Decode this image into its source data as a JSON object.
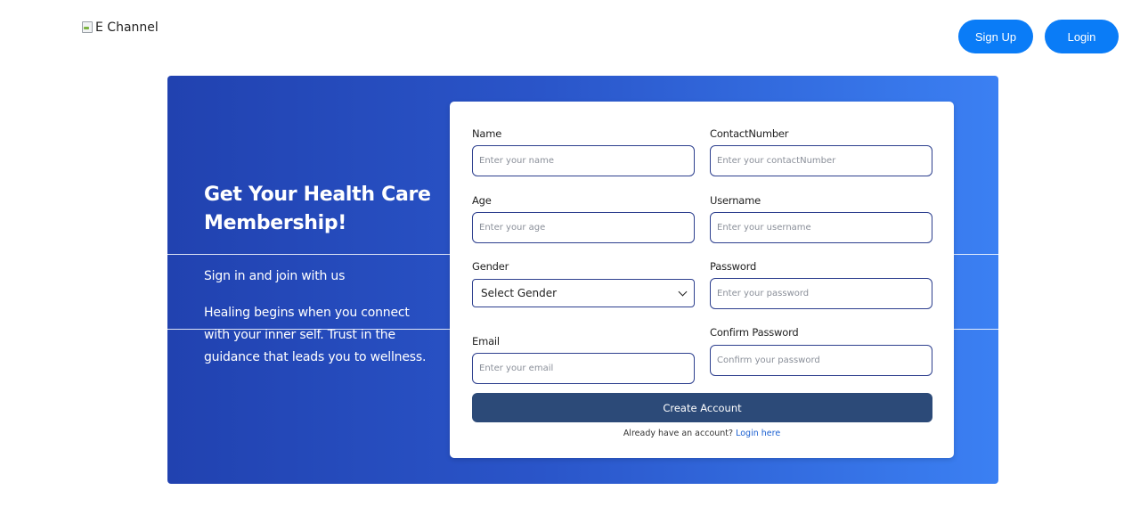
{
  "header": {
    "logo_alt": "E Channel",
    "signup_label": "Sign Up",
    "login_label": "Login"
  },
  "hero": {
    "title": "Get Your Health Care Membership!",
    "subtitle": "Sign in and join with us",
    "description": "Healing begins when you connect with your inner self. Trust in the guidance that leads you to wellness."
  },
  "form": {
    "name": {
      "label": "Name",
      "placeholder": "Enter your name"
    },
    "contact": {
      "label": "ContactNumber",
      "placeholder": "Enter your contactNumber"
    },
    "age": {
      "label": "Age",
      "placeholder": "Enter your age"
    },
    "username": {
      "label": "Username",
      "placeholder": "Enter your username"
    },
    "gender": {
      "label": "Gender",
      "selected": "Select Gender"
    },
    "password": {
      "label": "Password",
      "placeholder": "Enter your password"
    },
    "email": {
      "label": "Email",
      "placeholder": "Enter your email"
    },
    "confirm_password": {
      "label": "Confirm Password",
      "placeholder": "Confirm your password"
    },
    "submit_label": "Create Account",
    "login_prompt": "Already have an account?",
    "login_link": "Login here"
  },
  "colors": {
    "primary_button": "#0a7cf7",
    "banner_start": "#2142b0",
    "banner_end": "#3b80f3",
    "submit_button": "#2c4a78",
    "link": "#1a5fd1"
  }
}
